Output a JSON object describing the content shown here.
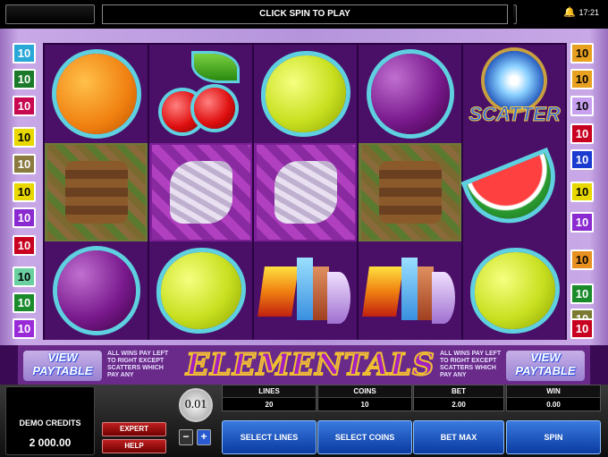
{
  "top_bar": {
    "message": "CLICK SPIN TO PLAY",
    "clock": "17:21",
    "icon": "bell-icon"
  },
  "line_numbers_left": [
    {
      "label": "10",
      "color": "#29a8d8"
    },
    {
      "label": "10",
      "color": "#1a7a2a"
    },
    {
      "label": "10",
      "color": "#c80850"
    },
    {
      "label": "10",
      "color": "#e8d800"
    },
    {
      "label": "10",
      "color": "#8a7a40"
    },
    {
      "label": "10",
      "color": "#e8d800"
    },
    {
      "label": "10",
      "color": "#8a2ad0"
    },
    {
      "label": "10",
      "color": "#c80020"
    },
    {
      "label": "10",
      "color": "#6ad0a0"
    },
    {
      "label": "10",
      "color": "#1a8a2a"
    },
    {
      "label": "10",
      "color": "#9a2ad8"
    }
  ],
  "line_numbers_right": [
    {
      "label": "10",
      "color": "#e8a020"
    },
    {
      "label": "10",
      "color": "#e8a020"
    },
    {
      "label": "10",
      "color": "#c8a0f0"
    },
    {
      "label": "10",
      "color": "#c80020"
    },
    {
      "label": "10",
      "color": "#1a3ad0"
    },
    {
      "label": "10",
      "color": "#e8d800"
    },
    {
      "label": "10",
      "color": "#8a2ad0"
    },
    {
      "label": "10",
      "color": "#e89020"
    },
    {
      "label": "10",
      "color": "#1a8a2a"
    },
    {
      "label": "10",
      "color": "#7a7a30"
    },
    {
      "label": "10",
      "color": "#c80020"
    }
  ],
  "reels": [
    [
      "orange",
      "earth-golem",
      "plum"
    ],
    [
      "cherry",
      "spirit",
      "lemon"
    ],
    [
      "lemon",
      "spirit",
      "wild"
    ],
    [
      "plum",
      "earth-golem",
      "wild"
    ],
    [
      "scatter",
      "watermelon",
      "lemon"
    ]
  ],
  "scatter_text": "SCATTER",
  "info": {
    "view_paytable": "VIEW PAYTABLE",
    "rules_left": "ALL WINS PAY LEFT TO RIGHT EXCEPT SCATTERS WHICH PAY ANY",
    "rules_right": "ALL WINS PAY LEFT TO RIGHT EXCEPT SCATTERS WHICH PAY ANY",
    "logo": "ELEMENTALS"
  },
  "console": {
    "credits_label": "DEMO CREDITS",
    "credits_value": "2 000.00",
    "expert_label": "EXPERT",
    "help_label": "HELP",
    "coin_value": "0.01",
    "minus_label": "−",
    "plus_label": "+",
    "stats": [
      {
        "label": "LINES",
        "value": "20"
      },
      {
        "label": "COINS",
        "value": "10"
      },
      {
        "label": "BET",
        "value": "2.00"
      },
      {
        "label": "WIN",
        "value": "0.00"
      }
    ],
    "buttons": [
      "SELECT LINES",
      "SELECT COINS",
      "BET MAX",
      "SPIN"
    ]
  }
}
